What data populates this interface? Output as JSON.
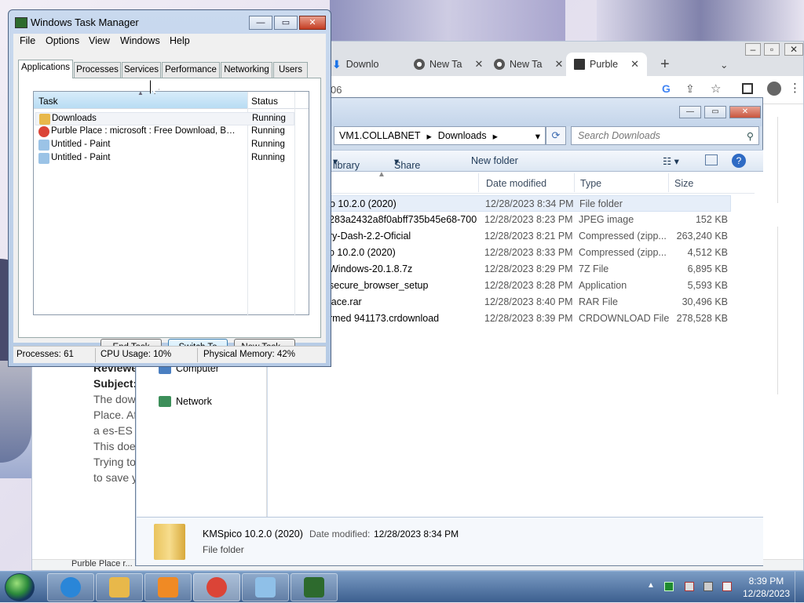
{
  "chrome": {
    "tabs": [
      {
        "label": "Downlo",
        "icon": "download-icon"
      },
      {
        "label": "New Ta",
        "icon": "chrome-icon"
      },
      {
        "label": "New Ta",
        "icon": "chrome-icon"
      },
      {
        "label": "Purble",
        "icon": "archive-icon"
      }
    ],
    "new_tab": "+",
    "url_fragment": "06",
    "page_text": {
      "reviewed": "Reviewe",
      "subject": "Subject:",
      "lines": [
        "The dow",
        "Place. Af",
        "a es-ES",
        "This doe",
        "Trying to",
        "to save y"
      ]
    },
    "bottom_item": "Purble Place r..."
  },
  "explorer": {
    "path": [
      "VM1.COLLABNET",
      "Downloads"
    ],
    "search_placeholder": "Search Downloads",
    "commands": {
      "library": "library",
      "share_with": "Share with",
      "new_folder": "New folder"
    },
    "columns": {
      "date": "Date modified",
      "type": "Type",
      "size": "Size"
    },
    "files": [
      {
        "name": "o 10.2.0 (2020)",
        "date": "12/28/2023 8:34 PM",
        "type": "File folder",
        "size": ""
      },
      {
        "name": "283a2432a8f0abff735b45e68-700",
        "date": "12/28/2023 8:23 PM",
        "type": "JPEG image",
        "size": "152 KB"
      },
      {
        "name": "ry-Dash-2.2-Oficial",
        "date": "12/28/2023 8:21 PM",
        "type": "Compressed (zipp...",
        "size": "263,240 KB"
      },
      {
        "name": "o 10.2.0 (2020)",
        "date": "12/28/2023 8:33 PM",
        "type": "Compressed (zipp...",
        "size": "4,512 KB"
      },
      {
        "name": "Windows-20.1.8.7z",
        "date": "12/28/2023 8:29 PM",
        "type": "7Z File",
        "size": "6,895 KB"
      },
      {
        "name": "secure_browser_setup",
        "date": "12/28/2023 8:28 PM",
        "type": "Application",
        "size": "5,593 KB"
      },
      {
        "name": "lace.rar",
        "date": "12/28/2023 8:40 PM",
        "type": "RAR File",
        "size": "30,496 KB"
      },
      {
        "name": "rmed 941173.crdownload",
        "date": "12/28/2023 8:39 PM",
        "type": "CRDOWNLOAD File",
        "size": "278,528 KB"
      }
    ],
    "nav": {
      "computer": "Computer",
      "network": "Network"
    },
    "details": {
      "name": "KMSpico 10.2.0 (2020)",
      "date_label": "Date modified:",
      "date_value": "12/28/2023 8:34 PM",
      "type": "File folder"
    }
  },
  "taskmgr": {
    "title": "Windows Task Manager",
    "menu": [
      "File",
      "Options",
      "View",
      "Windows",
      "Help"
    ],
    "tabs": [
      "Applications",
      "Processes",
      "Services",
      "Performance",
      "Networking",
      "Users"
    ],
    "active_tab": "Applications",
    "columns": {
      "task": "Task",
      "status": "Status"
    },
    "tasks": [
      {
        "name": "Downloads",
        "status": "Running",
        "icon": "folder-icon",
        "color": "#e8b84a"
      },
      {
        "name": "Purble Place : microsoft : Free Download, Borro...",
        "status": "Running",
        "icon": "chrome-icon",
        "color": "#db4437"
      },
      {
        "name": "Untitled - Paint",
        "status": "Running",
        "icon": "paint-icon",
        "color": "#9bc3e6"
      },
      {
        "name": "Untitled - Paint",
        "status": "Running",
        "icon": "paint-icon",
        "color": "#9bc3e6"
      }
    ],
    "buttons": {
      "end_task": "End Task",
      "switch_to": "Switch To",
      "new_task": "New Task..."
    },
    "status": {
      "processes": "Processes: 61",
      "cpu": "CPU Usage: 10%",
      "memory": "Physical Memory: 42%"
    }
  },
  "taskbar": {
    "time": "8:39 PM",
    "date": "12/28/2023",
    "apps": [
      {
        "name": "ie-icon",
        "color": "#2a86d8"
      },
      {
        "name": "explorer-icon",
        "color": "#e8b84a"
      },
      {
        "name": "media-player-icon",
        "color": "#f08a24"
      },
      {
        "name": "chrome-icon",
        "color": "#db4437"
      },
      {
        "name": "paint-icon",
        "color": "#8fc0e8"
      },
      {
        "name": "task-manager-icon",
        "color": "#2d6a2d"
      }
    ]
  }
}
